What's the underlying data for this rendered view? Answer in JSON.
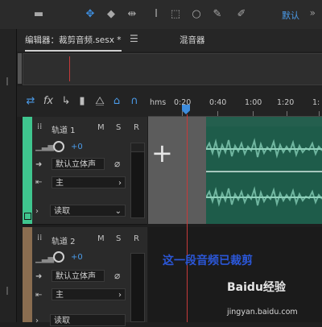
{
  "toolbar": {
    "icons": [
      "selection-tool-icon",
      "move-tool-icon",
      "razor-tool-icon",
      "time-selection-tool-icon",
      "marquee-tool-icon",
      "lasso-tool-icon",
      "brush-tool-icon",
      "spot-healing-tool-icon"
    ],
    "workspace_label": "默认",
    "more": "»"
  },
  "editor": {
    "tab_label": "编辑器：裁剪音频.sesx *",
    "menu_glyph": "☰",
    "mixer_label": "混音器"
  },
  "ruler": {
    "labels": [
      "hms",
      "0:20",
      "0:40",
      "1:00",
      "1:20",
      "1:"
    ]
  },
  "tracks": [
    {
      "name": "轨道 1",
      "m": "M",
      "s": "S",
      "r": "R",
      "volume": "+0",
      "input": "默认立体声",
      "output": "主",
      "mode": "读取",
      "color": "#3fc58e"
    },
    {
      "name": "轨道 2",
      "m": "M",
      "s": "S",
      "r": "R",
      "volume": "+0",
      "input": "默认立体声",
      "output": "主",
      "mode": "读取",
      "color": "#8a6d50"
    }
  ],
  "annotation": "这一段音频已裁剪",
  "watermark": {
    "brand": "Baidu经验",
    "url": "jingyan.baidu.com"
  }
}
